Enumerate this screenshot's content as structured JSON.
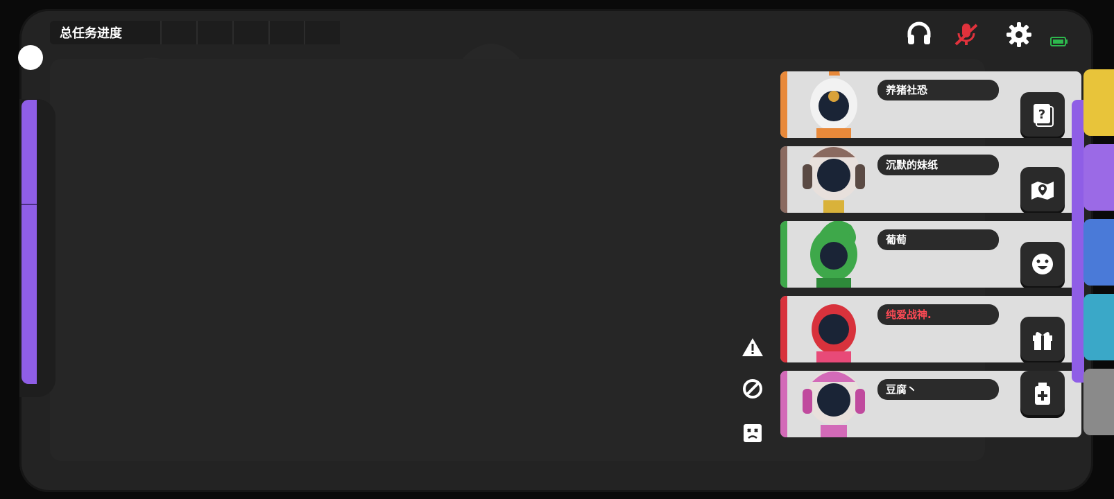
{
  "hud": {
    "progress_label": "总任务进度",
    "progress_segments": 5,
    "battery_color": "#2db84d"
  },
  "top_icons": [
    {
      "name": "headset-icon"
    },
    {
      "name": "mic-muted-icon",
      "color": "#e0323c"
    },
    {
      "name": "gear-icon"
    },
    {
      "name": "battery-icon"
    }
  ],
  "players": [
    {
      "name": "养猪社恐",
      "color": "#e8893a",
      "name_color": "#ffffff",
      "action_icon": "question-card-icon"
    },
    {
      "name": "沉默的妹纸",
      "color": "#8a6a60",
      "name_color": "#ffffff",
      "action_icon": "map-pin-icon"
    },
    {
      "name": "葡萄",
      "color": "#3ea84a",
      "name_color": "#ffffff",
      "action_icon": "emoji-icon"
    },
    {
      "name": "纯爱战神.",
      "color": "#d8323c",
      "name_color": "#ff4a55",
      "action_icon": "gift-icon"
    },
    {
      "name": "豆腐丶",
      "color": "#d36ab8",
      "name_color": "#ffffff",
      "action_icon": "medkit-icon"
    }
  ],
  "side_icons": [
    "warning-icon",
    "ban-icon",
    "dead-face-icon"
  ],
  "right_column_colors": [
    "#e8c43a",
    "#9b6ae6",
    "#4a7ad8",
    "#3aa8c8",
    "#8a8a8a"
  ]
}
